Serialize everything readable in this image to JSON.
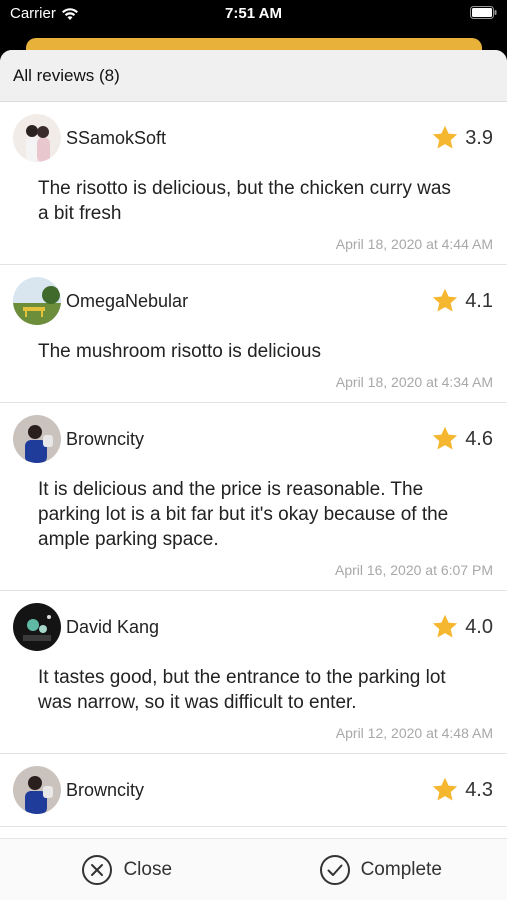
{
  "status_bar": {
    "carrier": "Carrier",
    "time": "7:51 AM"
  },
  "sheet": {
    "title": "All reviews (8)"
  },
  "reviews": [
    {
      "user": "SSamokSoft",
      "rating": "3.9",
      "text": "The risotto is delicious, but the chicken curry was a bit fresh",
      "date": "April 18, 2020 at 4:44 AM",
      "avatar": "couple-photo"
    },
    {
      "user": "OmegaNebular",
      "rating": "4.1",
      "text": "The mushroom risotto is delicious",
      "date": "April 18, 2020 at 4:34 AM",
      "avatar": "park-bench-photo"
    },
    {
      "user": "Browncity",
      "rating": "4.6",
      "text": "It is delicious and the price is reasonable. The parking lot is a bit far but it's okay because of the ample parking space.",
      "date": "April 16, 2020 at 6:07 PM",
      "avatar": "person-blue-jacket-photo"
    },
    {
      "user": "David Kang",
      "rating": "4.0",
      "text": "It tastes good, but the entrance to the parking lot was narrow, so it was difficult to enter.",
      "date": "April 12, 2020 at 4:48 AM",
      "avatar": "night-lights-photo"
    },
    {
      "user": "Browncity",
      "rating": "4.3",
      "text": "",
      "date": "",
      "avatar": "person-blue-jacket-photo"
    }
  ],
  "bottom_bar": {
    "close_label": "Close",
    "complete_label": "Complete"
  },
  "colors": {
    "star": "#f5b730",
    "accent_card": "#e8b23a"
  }
}
